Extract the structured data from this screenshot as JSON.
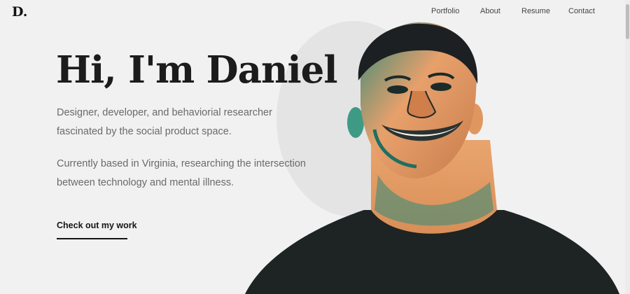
{
  "brand": {
    "logo": "D."
  },
  "nav": {
    "items": [
      {
        "label": "Portfolio"
      },
      {
        "label": "About"
      },
      {
        "label": "Resume"
      },
      {
        "label": "Contact"
      }
    ]
  },
  "hero": {
    "headline": "Hi, I'm Daniel",
    "paragraphs": [
      {
        "lines": [
          "Designer, developer, and behaviorial researcher",
          "fascinated by the social product space."
        ]
      },
      {
        "lines": [
          "Currently based in Virginia, researching the intersection",
          "between technology and mental illness."
        ]
      }
    ],
    "cta_label": "Check out my work",
    "portrait_icon": "smiling-man-portrait"
  },
  "colors": {
    "background": "#f1f1f1",
    "text_dark": "#1c1c1c",
    "text_muted": "#6a6a6a",
    "shirt": "#1e2324",
    "skin_teal": "#2f8a7a",
    "skin_orange": "#e8a06b"
  }
}
